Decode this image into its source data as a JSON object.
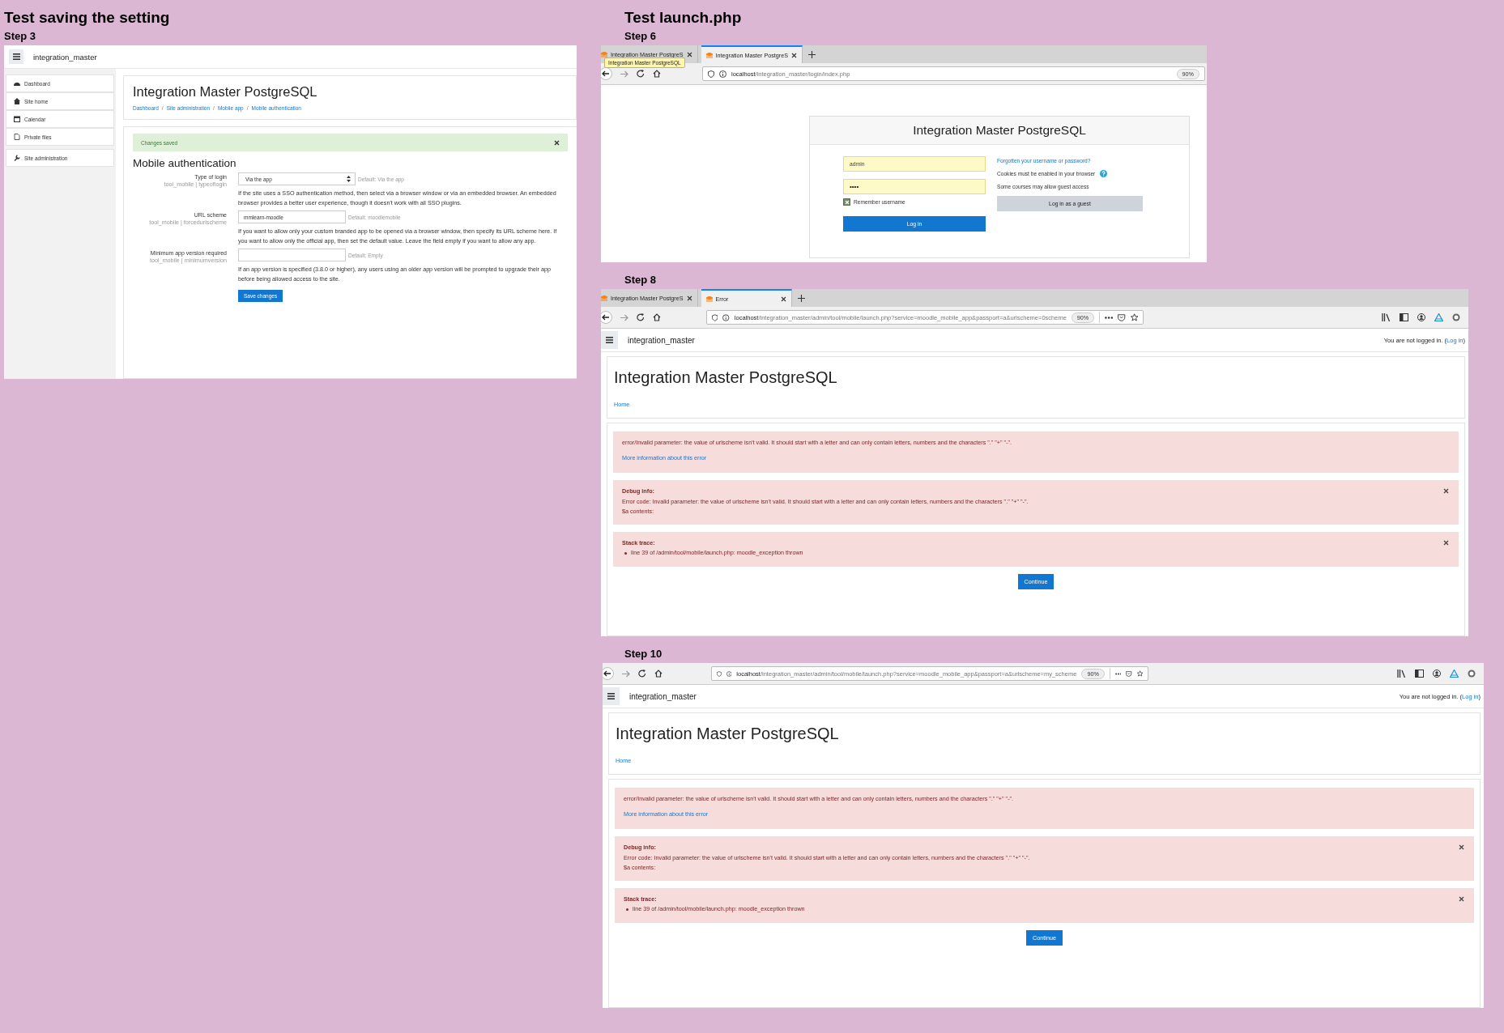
{
  "sections": [
    {
      "title": "Test saving the setting",
      "steps": [
        {
          "label": "Step 3",
          "screen": {
            "kind": "settings",
            "site_name": "integration_master",
            "nav_groups": [
              [
                {
                  "label": "Dashboard"
                },
                {
                  "label": "Site home"
                },
                {
                  "label": "Calendar"
                },
                {
                  "label": "Private files"
                }
              ],
              [
                {
                  "label": "Site administration"
                }
              ]
            ],
            "heading": "Integration Master PostgreSQL",
            "breadcrumb": [
              {
                "label": "Dashboard",
                "separator": "/"
              },
              {
                "label": "Site administration",
                "separator": "/"
              },
              {
                "label": "Mobile app",
                "separator": "/"
              },
              {
                "label": "Mobile authentication"
              }
            ],
            "alert": "Changes saved",
            "section_title": "Mobile authentication",
            "settings": [
              {
                "kind": "select",
                "label": "Type of login",
                "setting_id": "tool_mobile | typeoflogin",
                "value": "Via the app",
                "default": "Default: Via the app",
                "description": "If the site uses a SSO authentication method, then select via a browser window or via an embedded browser. An embedded browser provides a better user experience, though it doesn't work with all SSO plugins."
              },
              {
                "kind": "text",
                "label": "URL scheme",
                "setting_id": "tool_mobile | forcedurlscheme",
                "value": "mmlearn-moodle",
                "default": "Default: moodlemobile",
                "description": "If you want to allow only your custom branded app to be opened via a browser window, then specify its URL scheme here. If you want to allow only the official app, then set the default value. Leave the field empty if you want to allow any app."
              },
              {
                "kind": "text",
                "label": "Minimum app version required",
                "setting_id": "tool_mobile | minimumversion",
                "default": "Default: Empty",
                "description": "If an app version is specified (3.8.0 or higher), any users using an older app version will be prompted to upgrade their app before being allowed access to the site."
              }
            ],
            "save_button": "Save changes"
          }
        }
      ]
    },
    {
      "title": "Test launch.php",
      "steps": [
        {
          "label": "Step 6",
          "screen": {
            "kind": "login",
            "tabs": [
              {
                "title": "Integration Master PostgreS",
                "selected": false
              },
              {
                "title": "Integration Master PostgreS",
                "selected": true
              }
            ],
            "tooltip": "Integration Master PostgreSQL",
            "url": {
              "host": "localhost",
              "path": "/integration_master/login/index.php"
            },
            "zoom": "90%",
            "heading": "Integration Master PostgreSQL",
            "username": "admin",
            "password": "••••",
            "remember": {
              "label": "Remember username",
              "checked": true
            },
            "login_button": "Log in",
            "forgot_link": "Forgotten your username or password?",
            "cookies_note": "Cookies must be enabled in your browser",
            "guest_note": "Some courses may allow guest access",
            "guest_button": "Log in as a guest"
          }
        },
        {
          "label": "Step 8",
          "screen": {
            "kind": "error",
            "tabs": [
              {
                "title": "Integration Master PostgreS",
                "selected": false
              },
              {
                "title": "Error",
                "selected": true
              }
            ],
            "url": {
              "host": "localhost",
              "path": "/integration_master/admin/tool/mobile/launch.php?service=moodle_mobile_app&passport=a&urlscheme=0scheme"
            },
            "zoom": "90%",
            "site_name": "integration_master",
            "login_status": {
              "before": "You are not logged in. (",
              "link": "Log in",
              "after": ")"
            },
            "heading": "Integration Master PostgreSQL",
            "breadcrumb": [
              {
                "label": "Home"
              }
            ],
            "error": "error/Invalid parameter: the value of urlscheme isn't valid. It should start with a letter and can only contain letters, numbers and the characters \".\" \"+\" \"-\".",
            "more_info_link": "More information about this error",
            "debug": {
              "title": "Debug info:",
              "lines": [
                "Error code: Invalid parameter: the value of urlscheme isn't valid. It should start with a letter and can only contain letters, numbers and the characters \".\" \"+\" \"-\".",
                "$a contents:"
              ]
            },
            "stack": {
              "title": "Stack trace:",
              "items": [
                "line 39 of /admin/tool/mobile/launch.php: moodle_exception thrown"
              ]
            },
            "continue_button": "Continue"
          }
        },
        {
          "label": "Step 10",
          "screen": {
            "kind": "error",
            "url": {
              "host": "localhost",
              "path": "/integration_master/admin/tool/mobile/launch.php?service=moodle_mobile_app&passport=a&urlscheme=my_scheme"
            },
            "zoom": "90%",
            "site_name": "integration_master",
            "login_status": {
              "before": "You are not logged in. (",
              "link": "Log in",
              "after": ")"
            },
            "heading": "Integration Master PostgreSQL",
            "breadcrumb": [
              {
                "label": "Home"
              }
            ],
            "error": "error/Invalid parameter: the value of urlscheme isn't valid. It should start with a letter and can only contain letters, numbers and the characters \".\" \"+\" \"-\".",
            "more_info_link": "More information about this error",
            "debug": {
              "title": "Debug info:",
              "lines": [
                "Error code: Invalid parameter: the value of urlscheme isn't valid. It should start with a letter and can only contain letters, numbers and the characters \".\" \"+\" \"-\".",
                "$a contents:"
              ]
            },
            "stack": {
              "title": "Stack trace:",
              "items": [
                "line 39 of /admin/tool/mobile/launch.php: moodle_exception thrown"
              ]
            },
            "continue_button": "Continue"
          }
        }
      ]
    }
  ]
}
